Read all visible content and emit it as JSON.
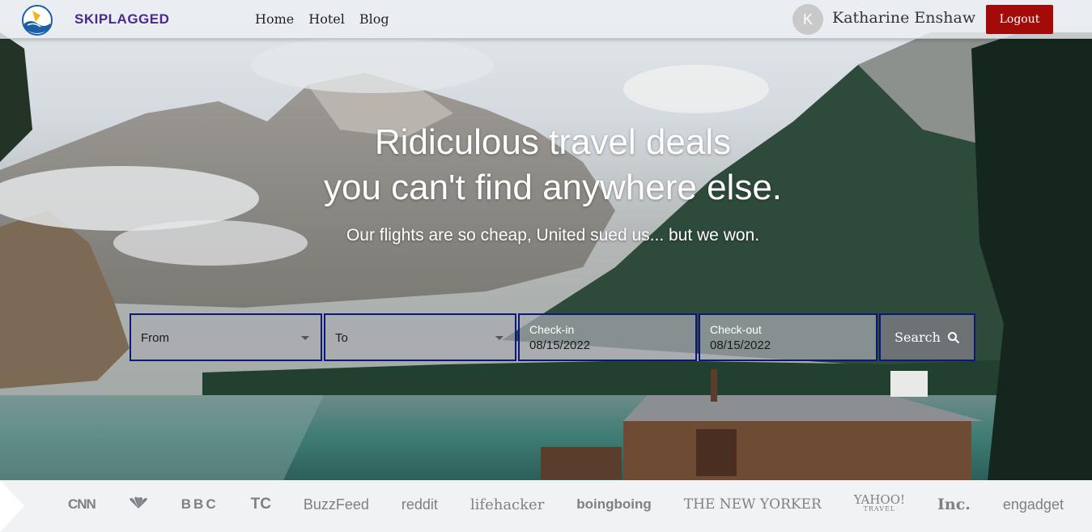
{
  "brand": {
    "name": "SKIPLAGGED",
    "logo_icon": "skiplagged-globe-logo"
  },
  "nav": {
    "links": [
      "Home",
      "Hotel",
      "Blog"
    ]
  },
  "user": {
    "avatar_initial": "K",
    "name": "Katharine Enshaw",
    "logout_label": "Logout"
  },
  "hero": {
    "headline_line1": "Ridiculous travel deals",
    "headline_line2": "you can't find anywhere else.",
    "subline": "Our flights are so cheap, United sued us... but we won."
  },
  "search": {
    "from_placeholder": "From",
    "to_placeholder": "To",
    "checkin_label": "Check-in",
    "checkin_value": "08/15/2022",
    "checkout_label": "Check-out",
    "checkout_value": "08/15/2022",
    "search_label": "Search",
    "search_icon": "magnifier-icon"
  },
  "press": {
    "logos": [
      "CNN",
      "NBC",
      "BBC",
      "TC",
      "BuzzFeed",
      "reddit",
      "lifehacker",
      "boingboing",
      "THE NEW YORKER",
      "YAHOO!",
      "TRAVEL",
      "Inc.",
      "engadget"
    ]
  },
  "colors": {
    "brand_purple": "#4b2a8c",
    "logout_red": "#a30b0b",
    "field_border": "#0b1a7a"
  }
}
